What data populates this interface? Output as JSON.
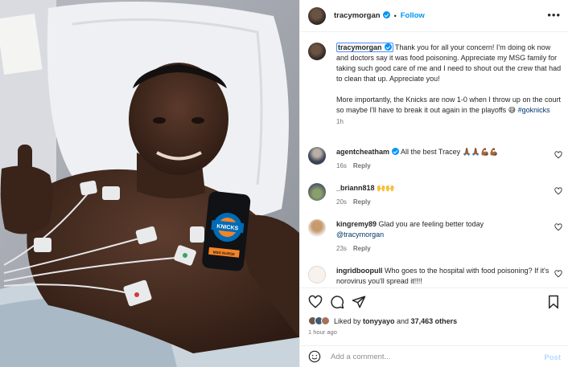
{
  "header": {
    "username": "tracymorgan",
    "separator": "•",
    "follow_label": "Follow",
    "more_label": "•••"
  },
  "caption": {
    "username": "tracymorgan",
    "text_1": "Thank you for all your concern! I'm doing ok now and doctors say it was food poisoning. Appreciate my MSG family for taking such good care of me and I need to shout out the crew that had to clean that up. Appreciate you!",
    "text_2": "More importantly, the Knicks are now 1-0 when I throw up on the court so maybe I'll have to break it out again in the playoffs 😅 ",
    "hashtag": "#goknicks",
    "time": "1h"
  },
  "comments": [
    {
      "username": "agentcheatham",
      "text": "All the best Tracey 🙏🏾🙏🏾💪🏾💪🏾",
      "time": "16s",
      "reply": "Reply"
    },
    {
      "username": "_briann818",
      "text": "🙌🙌",
      "time": "20s",
      "reply": "Reply"
    },
    {
      "username": "kingremy89",
      "text": "Glad you are feeling better today ",
      "mention": "@tracymorgan",
      "time": "23s",
      "reply": "Reply"
    },
    {
      "username": "ingridboopull",
      "text": "Who goes to the hospital with food poisoning? If it's norovirus you'll spread it!!!!"
    }
  ],
  "likes": {
    "prefix": "Liked by ",
    "user": "tonyyayo",
    "mid": " and ",
    "count": "37,463 others"
  },
  "post_time": "1 hour ago",
  "add_comment": {
    "placeholder": "Add a comment...",
    "post_label": "Post"
  },
  "photo": {
    "phone_case_text": "KNICKS",
    "label_text": "MSG NURSE",
    "colors": {
      "knicks_orange": "#f58426",
      "knicks_blue": "#006bb6"
    }
  },
  "colors": {
    "accent": "#0095f6",
    "link": "#00376b",
    "muted": "#737373"
  },
  "icons": [
    "heart-icon",
    "comment-icon",
    "share-icon",
    "bookmark-icon",
    "emoji-icon",
    "verified-icon",
    "more-icon"
  ]
}
